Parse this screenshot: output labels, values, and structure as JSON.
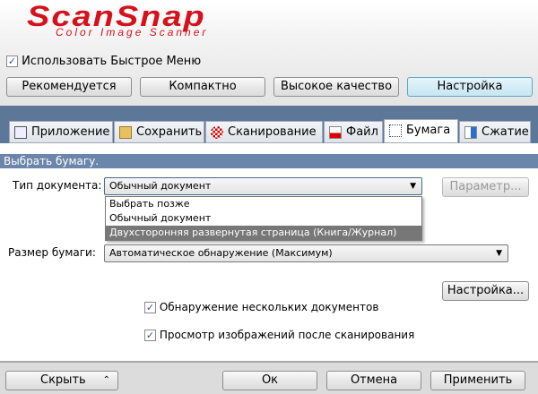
{
  "logo": {
    "title": "ScanSnap",
    "subtitle": "Color Image Scanner"
  },
  "quick_menu": {
    "label": "Использовать Быстрое Меню",
    "checked": true
  },
  "presets": [
    "Рекомендуется",
    "Компактно",
    "Высокое качество",
    "Настройка"
  ],
  "tabs": [
    {
      "label": "Приложение",
      "icon": "application-icon"
    },
    {
      "label": "Сохранить",
      "icon": "folder-icon"
    },
    {
      "label": "Сканирование",
      "icon": "scan-icon"
    },
    {
      "label": "Файл",
      "icon": "file-icon"
    },
    {
      "label": "Бумага",
      "icon": "paper-icon",
      "active": true
    },
    {
      "label": "Сжатие",
      "icon": "compression-icon"
    }
  ],
  "section_header": "Выбрать бумагу.",
  "doc_type": {
    "label": "Тип документа:",
    "value": "Обычный документ",
    "options": [
      "Выбрать позже",
      "Обычный документ",
      "Двухсторонняя развернутая страница (Книга/Журнал)"
    ],
    "highlighted": "Двухсторонняя развернутая страница (Книга/Журнал)"
  },
  "param_button": "Параметр...",
  "paper_size": {
    "label": "Размер бумаги:",
    "value": "Автоматическое обнаружение (Максимум)"
  },
  "settings_button": "Настройка...",
  "checks": [
    {
      "label": "Обнаружение нескольких документов",
      "checked": true
    },
    {
      "label": "Просмотр изображений после сканирования",
      "checked": true
    }
  ],
  "footer": {
    "hide": "Скрыть",
    "ok": "Ок",
    "cancel": "Отмена",
    "apply": "Применить"
  }
}
